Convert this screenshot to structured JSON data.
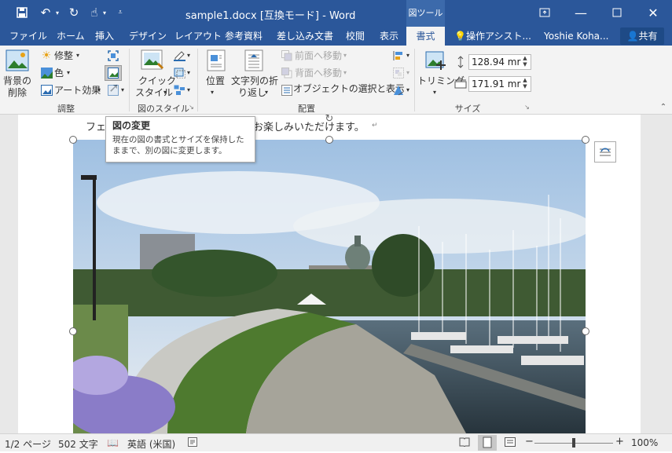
{
  "window": {
    "title": "sample1.docx [互換モード] - Word",
    "context_tab_group": "図ツール"
  },
  "tabs": [
    "ファイル",
    "ホーム",
    "挿入",
    "デザイン",
    "レイアウト",
    "参考資料",
    "差し込み文書",
    "校閲",
    "表示",
    "書式"
  ],
  "assist": "操作アシスト...",
  "user": "Yoshie Koha...",
  "share": "共有",
  "ribbon": {
    "adjust": {
      "remove_bg_1": "背景の",
      "remove_bg_2": "削除",
      "corrections": "修整",
      "color": "色",
      "artistic": "アート効果",
      "group": "調整"
    },
    "styles": {
      "quick_1": "クイック",
      "quick_2": "スタイル",
      "group": "図のスタイル"
    },
    "arrange": {
      "position": "位置",
      "wrap_1": "文字列の折",
      "wrap_2": "り返し",
      "bring_forward": "前面へ移動",
      "send_backward": "背面へ移動",
      "selection_pane": "オブジェクトの選択と表示",
      "group": "配置"
    },
    "size": {
      "crop": "トリミング",
      "height": "128.94 mr",
      "width": "171.91 mr",
      "group": "サイズ"
    }
  },
  "document": {
    "line_start": "フェ",
    "line_end": "お楽しみいただけます。"
  },
  "tooltip": {
    "title": "図の変更",
    "body_1": "現在の図の書式とサイズを保持した",
    "body_2": "ままで、別の図に変更します。"
  },
  "status": {
    "page": "1/2 ページ",
    "words": "502 文字",
    "language": "英語 (米国)",
    "zoom": "100%"
  }
}
